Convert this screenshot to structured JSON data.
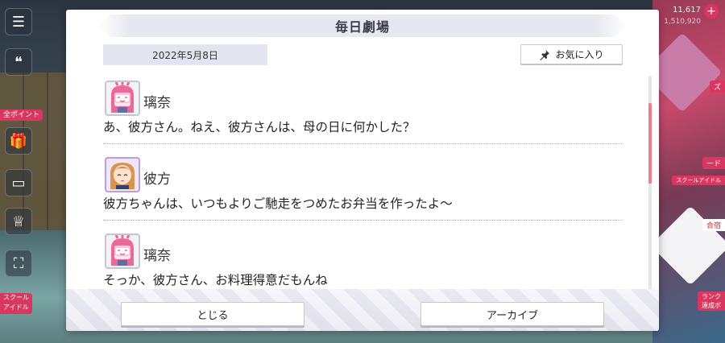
{
  "background": {
    "counter_main": "11,617",
    "counter_sub": "1,510,920",
    "left_tags": [
      "全ポイント",
      "スクール\nアイドル"
    ],
    "right_tags": [
      "ズ",
      "ード",
      "スクールアイドル",
      "合宿",
      "ランク\n達成ボ"
    ]
  },
  "dialog": {
    "title": "毎日劇場",
    "date": "2022年5月8日",
    "favorite_label": "お気に入り",
    "entries": [
      {
        "speaker": "璃奈",
        "avatar": "rina-avatar",
        "line": "あ、彼方さん。ねえ、彼方さんは、母の日に何かした？"
      },
      {
        "speaker": "彼方",
        "avatar": "kanata-avatar",
        "line": "彼方ちゃんは、いつもよりご馳走をつめたお弁当を作ったよ〜"
      },
      {
        "speaker": "璃奈",
        "avatar": "rina-avatar",
        "line": "そっか、彼方さん、お料理得意だもんね"
      }
    ],
    "close_label": "とじる",
    "archive_label": "アーカイブ"
  },
  "colors": {
    "accent": "#f07a8e",
    "game_pink": "#d9375f",
    "date_bg": "#e3e4ef"
  }
}
